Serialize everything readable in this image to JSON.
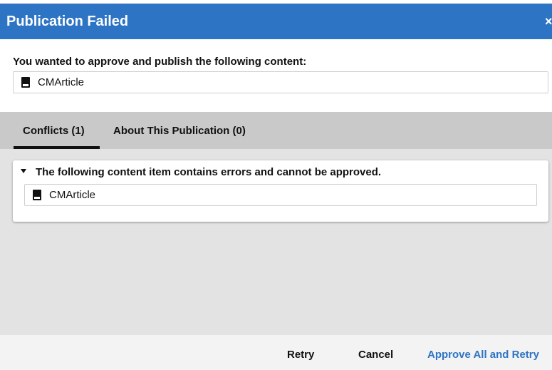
{
  "dialog": {
    "title": "Publication Failed",
    "close_glyph": "×",
    "header_color": "#2d74c4",
    "close_icon": "close-icon"
  },
  "prompt": {
    "text": "You wanted to approve and publish the following content:",
    "item": {
      "icon": "document-icon",
      "label": "CMArticle"
    }
  },
  "tabs": [
    {
      "label": "Conflicts (1)",
      "active": true
    },
    {
      "label": "About This Publication (0)",
      "active": false
    }
  ],
  "conflicts": {
    "group": {
      "expanded": true,
      "heading": "The following content item contains errors and cannot be approved.",
      "items": [
        {
          "icon": "document-icon",
          "label": "CMArticle"
        }
      ]
    }
  },
  "footer": {
    "retry_label": "Retry",
    "cancel_label": "Cancel",
    "approve_all_label": "Approve All and Retry",
    "accent_color": "#2d74c4"
  }
}
